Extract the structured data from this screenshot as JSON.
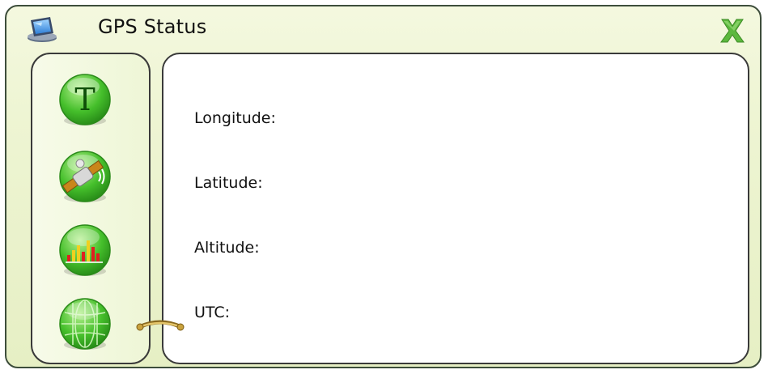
{
  "window": {
    "title": "GPS Status"
  },
  "side_buttons": [
    {
      "name": "text-mode",
      "glyph": "T"
    },
    {
      "name": "satellite-view"
    },
    {
      "name": "signal-strength"
    },
    {
      "name": "globe-view"
    }
  ],
  "fields": [
    {
      "label": "Longitude:",
      "value": ""
    },
    {
      "label": "Latitude:",
      "value": ""
    },
    {
      "label": "Altitude:",
      "value": ""
    },
    {
      "label": "UTC:",
      "value": ""
    }
  ],
  "colors": {
    "frame_bg": "#eef5d3",
    "button_green": "#3fb62a",
    "close_green": "#56b23a"
  }
}
